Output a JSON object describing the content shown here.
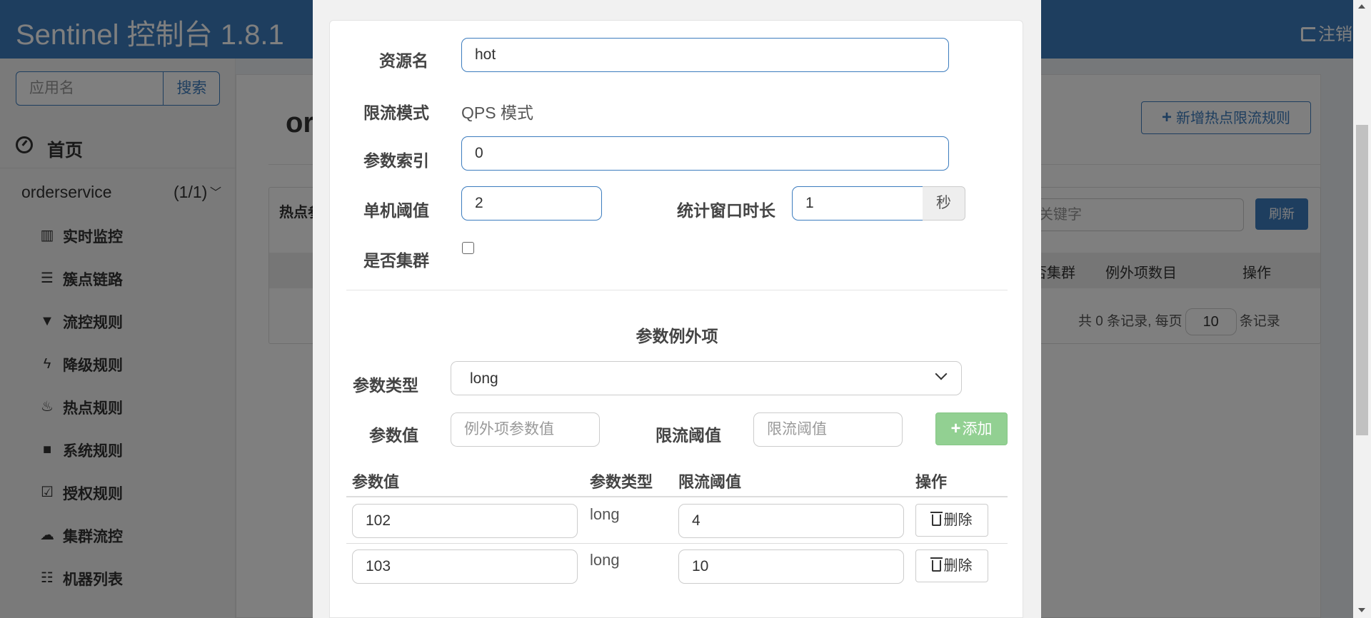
{
  "header": {
    "brand": "Sentinel 控制台 1.8.1",
    "logout": "注销"
  },
  "sidebar": {
    "search_placeholder": "应用名",
    "search_button": "搜索",
    "home": "首页",
    "app": {
      "name": "orderservice",
      "count": "(1/1)"
    },
    "menu": [
      {
        "label": "实时监控",
        "icon": "bar-chart-icon"
      },
      {
        "label": "簇点链路",
        "icon": "list-icon"
      },
      {
        "label": "流控规则",
        "icon": "filter-icon"
      },
      {
        "label": "降级规则",
        "icon": "flash-icon"
      },
      {
        "label": "热点规则",
        "icon": "fire-icon"
      },
      {
        "label": "系统规则",
        "icon": "lock-icon"
      },
      {
        "label": "授权规则",
        "icon": "check-icon"
      },
      {
        "label": "集群流控",
        "icon": "cloud-icon"
      },
      {
        "label": "机器列表",
        "icon": "th-list-icon"
      }
    ]
  },
  "main": {
    "title_partial": "or",
    "add_rule_button": "新增热点限流规则",
    "table_head_label": "热点参",
    "keyword_placeholder": "关键字",
    "refresh_button": "刷新",
    "columns": [
      "否集群",
      "例外项数目",
      "操作"
    ],
    "pager": {
      "prefix": "共 0 条记录, 每页",
      "page_size": "10",
      "suffix": "条记录"
    }
  },
  "modal": {
    "resource_label": "资源名",
    "resource_value": "hot",
    "mode_label": "限流模式",
    "mode_value": "QPS 模式",
    "param_index_label": "参数索引",
    "param_index_value": "0",
    "threshold_label": "单机阈值",
    "threshold_value": "2",
    "window_label": "统计窗口时长",
    "window_value": "1",
    "window_unit": "秒",
    "cluster_label": "是否集群",
    "exceptions_title": "参数例外项",
    "param_type_label": "参数类型",
    "param_type_value": "long",
    "param_value_label": "参数值",
    "param_value_placeholder": "例外项参数值",
    "limit_label": "限流阈值",
    "limit_placeholder": "限流阈值",
    "add_button": "添加",
    "table_headers": [
      "参数值",
      "参数类型",
      "限流阈值",
      "操作"
    ],
    "rows": [
      {
        "value": "102",
        "type": "long",
        "limit": "4",
        "action": "删除"
      },
      {
        "value": "103",
        "type": "long",
        "limit": "10",
        "action": "删除"
      }
    ]
  },
  "colors": {
    "primary": "#3c7cbe",
    "success_disabled": "#92d092",
    "overlay": "rgba(0,0,0,0.5)"
  }
}
